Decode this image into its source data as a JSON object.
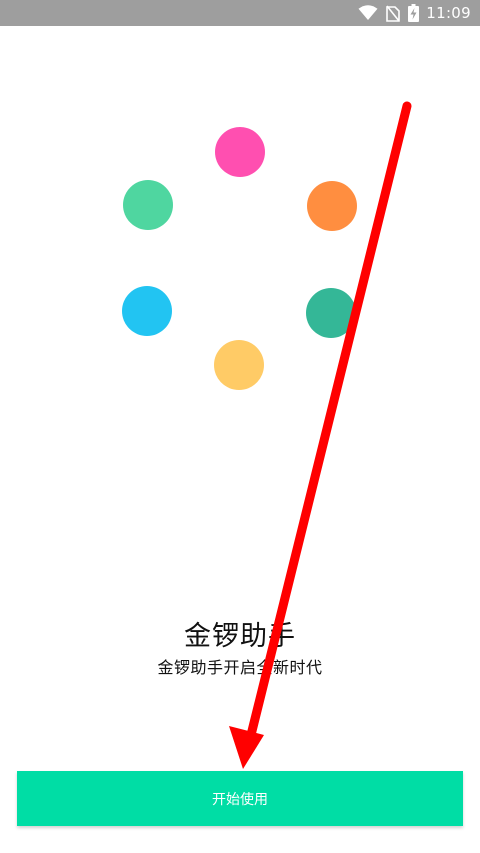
{
  "status_bar": {
    "time": "11:09",
    "icons": [
      "wifi-icon",
      "no-sim-icon",
      "battery-charging-icon"
    ]
  },
  "logo_dots": [
    {
      "name": "pink-dot",
      "color": "#FF4FB0"
    },
    {
      "name": "green-dot",
      "color": "#4FD6A0"
    },
    {
      "name": "orange-dot",
      "color": "#FF8E40"
    },
    {
      "name": "blue-dot",
      "color": "#22C4F2"
    },
    {
      "name": "teal-dot",
      "color": "#34B797"
    },
    {
      "name": "yellow-dot",
      "color": "#FFCB66"
    }
  ],
  "app": {
    "title": "金锣助手",
    "subtitle": "金锣助手开启全新时代"
  },
  "start_button": {
    "label": "开始使用",
    "color": "#00DDA5"
  },
  "colors": {
    "status_bar": "#9E9E9E",
    "annotation_arrow": "#FF0000"
  }
}
